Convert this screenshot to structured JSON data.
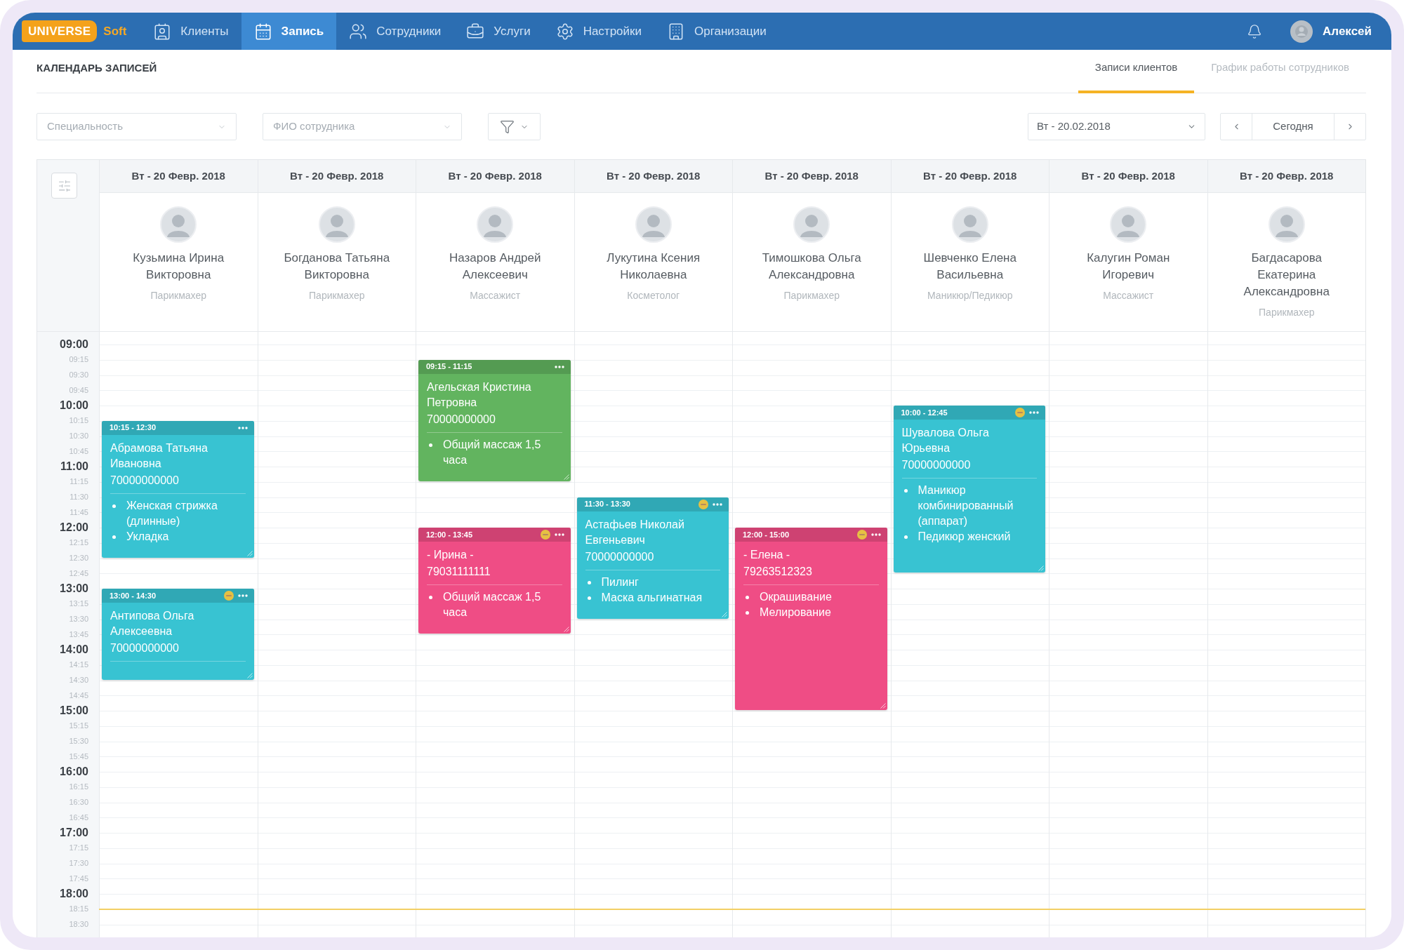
{
  "app_bar": {
    "logo": {
      "badge": "UNIVERSE",
      "text": "Soft"
    },
    "nav": [
      {
        "label": "Клиенты",
        "selected": false
      },
      {
        "label": "Запись",
        "selected": true
      },
      {
        "label": "Сотрудники",
        "selected": false
      },
      {
        "label": "Услуги",
        "selected": false
      },
      {
        "label": "Настройки",
        "selected": false
      },
      {
        "label": "Организации",
        "selected": false
      }
    ],
    "user": {
      "name": "Алексей"
    }
  },
  "page": {
    "title": "КАЛЕНДАРЬ ЗАПИСЕЙ",
    "tabs": [
      {
        "label": "Записи клиентов",
        "selected": true
      },
      {
        "label": "График работы сотрудников",
        "selected": false
      }
    ]
  },
  "toolbar": {
    "specialty": {
      "placeholder": "Специальность"
    },
    "employee": {
      "placeholder": "ФИО сотрудника"
    },
    "date": {
      "value": "Вт - 20.02.2018"
    },
    "today": {
      "label": "Сегодня"
    }
  },
  "calendar": {
    "time_slots": [
      {
        "label": "09:00",
        "kind": "hour"
      },
      {
        "label": "09:15",
        "kind": "quarter"
      },
      {
        "label": "09:30",
        "kind": "quarter"
      },
      {
        "label": "09:45",
        "kind": "quarter"
      },
      {
        "label": "10:00",
        "kind": "hour"
      },
      {
        "label": "10:15",
        "kind": "quarter"
      },
      {
        "label": "10:30",
        "kind": "quarter"
      },
      {
        "label": "10:45",
        "kind": "quarter"
      },
      {
        "label": "11:00",
        "kind": "hour"
      },
      {
        "label": "11:15",
        "kind": "quarter"
      },
      {
        "label": "11:30",
        "kind": "quarter"
      },
      {
        "label": "11:45",
        "kind": "quarter"
      },
      {
        "label": "12:00",
        "kind": "hour"
      },
      {
        "label": "12:15",
        "kind": "quarter"
      },
      {
        "label": "12:30",
        "kind": "quarter"
      },
      {
        "label": "12:45",
        "kind": "quarter"
      },
      {
        "label": "13:00",
        "kind": "hour"
      },
      {
        "label": "13:15",
        "kind": "quarter"
      },
      {
        "label": "13:30",
        "kind": "quarter"
      },
      {
        "label": "13:45",
        "kind": "quarter"
      },
      {
        "label": "14:00",
        "kind": "hour"
      },
      {
        "label": "14:15",
        "kind": "quarter"
      },
      {
        "label": "14:30",
        "kind": "quarter"
      },
      {
        "label": "14:45",
        "kind": "quarter"
      },
      {
        "label": "15:00",
        "kind": "hour"
      },
      {
        "label": "15:15",
        "kind": "quarter"
      },
      {
        "label": "15:30",
        "kind": "quarter"
      },
      {
        "label": "15:45",
        "kind": "quarter"
      },
      {
        "label": "16:00",
        "kind": "hour"
      },
      {
        "label": "16:15",
        "kind": "quarter"
      },
      {
        "label": "16:30",
        "kind": "quarter"
      },
      {
        "label": "16:45",
        "kind": "quarter"
      },
      {
        "label": "17:00",
        "kind": "hour"
      },
      {
        "label": "17:15",
        "kind": "quarter"
      },
      {
        "label": "17:30",
        "kind": "quarter"
      },
      {
        "label": "17:45",
        "kind": "quarter"
      },
      {
        "label": "18:00",
        "kind": "hour"
      },
      {
        "label": "18:15",
        "kind": "quarter"
      },
      {
        "label": "18:30",
        "kind": "quarter"
      }
    ],
    "columns": [
      {
        "date": "Вт - 20 Февр. 2018",
        "employee": {
          "name": "Кузьмина Ирина Викторовна",
          "role": "Парикмахер"
        },
        "appointments": [
          {
            "time": "10:15 - 12:30",
            "color": "#38c3d2",
            "flagged": false,
            "client": "Абрамова Татьяна Ивановна",
            "phone": "70000000000",
            "services": [
              "Женская стрижка (длинные)",
              "Укладка"
            ]
          },
          {
            "time": "13:00 - 14:30",
            "color": "#38c3d2",
            "flagged": true,
            "client": "Антипова Ольга Алексеевна",
            "phone": "70000000000"
          }
        ]
      },
      {
        "date": "Вт - 20 Февр. 2018",
        "employee": {
          "name": "Богданова Татьяна Викторовна",
          "role": "Парикмахер"
        }
      },
      {
        "date": "Вт - 20 Февр. 2018",
        "employee": {
          "name": "Назаров Андрей Алексеевич",
          "role": "Массажист"
        },
        "appointments": [
          {
            "time": "09:15 - 11:15",
            "color": "#62b45f",
            "flagged": false,
            "client": "Агельская Кристина Петровна",
            "phone": "70000000000",
            "services": [
              "Общий массаж 1,5 часа"
            ]
          },
          {
            "time": "12:00 - 13:45",
            "color": "#ef4d85",
            "flagged": true,
            "client": "- Ирина -",
            "phone": "79031111111",
            "services": [
              "Общий массаж 1,5 часа"
            ]
          }
        ]
      },
      {
        "date": "Вт - 20 Февр. 2018",
        "employee": {
          "name": "Лукутина Ксения Николаевна",
          "role": "Косметолог"
        },
        "appointments": [
          {
            "time": "11:30 - 13:30",
            "color": "#38c3d2",
            "flagged": true,
            "client": "Астафьев Николай Евгеньевич",
            "phone": "70000000000",
            "services": [
              "Пилинг",
              "Маска альгинатная"
            ]
          }
        ]
      },
      {
        "date": "Вт - 20 Февр. 2018",
        "employee": {
          "name": "Тимошкова Ольга Александровна",
          "role": "Парикмахер"
        },
        "appointments": [
          {
            "time": "12:00 - 15:00",
            "color": "#ef4d85",
            "flagged": true,
            "client": "- Елена -",
            "phone": "79263512323",
            "services": [
              "Окрашивание",
              "Мелирование"
            ]
          }
        ]
      },
      {
        "date": "Вт - 20 Февр. 2018",
        "employee": {
          "name": "Шевченко Елена Васильевна",
          "role": "Маникюр/Педикюр"
        },
        "appointments": [
          {
            "time": "10:00 - 12:45",
            "color": "#38c3d2",
            "flagged": true,
            "client": "Шувалова Ольга Юрьевна",
            "phone": "70000000000",
            "services": [
              "Маникюр комбинированный (аппарат)",
              "Педикюр женский"
            ]
          }
        ]
      },
      {
        "date": "Вт - 20 Февр. 2018",
        "employee": {
          "name": "Калугин Роман Игоревич",
          "role": "Массажист"
        }
      },
      {
        "date": "Вт - 20 Февр. 2018",
        "employee": {
          "name": "Багдасарова Екатерина Александровна",
          "role": "Парикмахер"
        }
      }
    ]
  }
}
